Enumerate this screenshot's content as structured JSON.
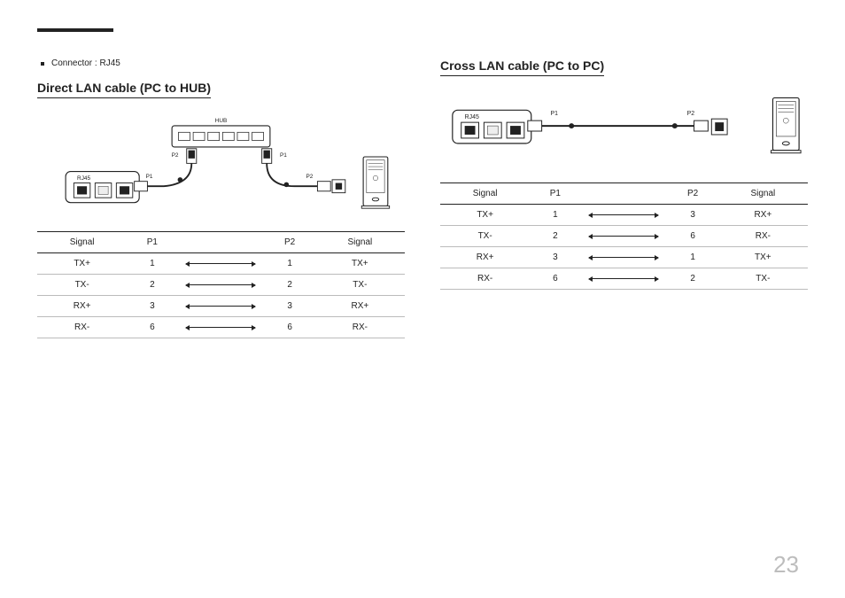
{
  "page_number": "23",
  "connector_note": "Connector : RJ45",
  "direct": {
    "title": "Direct LAN cable (PC to HUB)",
    "labels": {
      "hub": "HUB",
      "rj45": "RJ45",
      "p1": "P1",
      "p2": "P2"
    },
    "table": {
      "headers": [
        "Signal",
        "P1",
        "",
        "P2",
        "Signal"
      ],
      "rows": [
        [
          "TX+",
          "1",
          "arrow",
          "1",
          "TX+"
        ],
        [
          "TX-",
          "2",
          "arrow",
          "2",
          "TX-"
        ],
        [
          "RX+",
          "3",
          "arrow",
          "3",
          "RX+"
        ],
        [
          "RX-",
          "6",
          "arrow",
          "6",
          "RX-"
        ]
      ]
    }
  },
  "cross": {
    "title": "Cross LAN cable (PC to PC)",
    "labels": {
      "rj45": "RJ45",
      "p1": "P1",
      "p2": "P2"
    },
    "table": {
      "headers": [
        "Signal",
        "P1",
        "",
        "P2",
        "Signal"
      ],
      "rows": [
        [
          "TX+",
          "1",
          "arrow",
          "3",
          "RX+"
        ],
        [
          "TX-",
          "2",
          "arrow",
          "6",
          "RX-"
        ],
        [
          "RX+",
          "3",
          "arrow",
          "1",
          "TX+"
        ],
        [
          "RX-",
          "6",
          "arrow",
          "2",
          "TX-"
        ]
      ]
    }
  }
}
